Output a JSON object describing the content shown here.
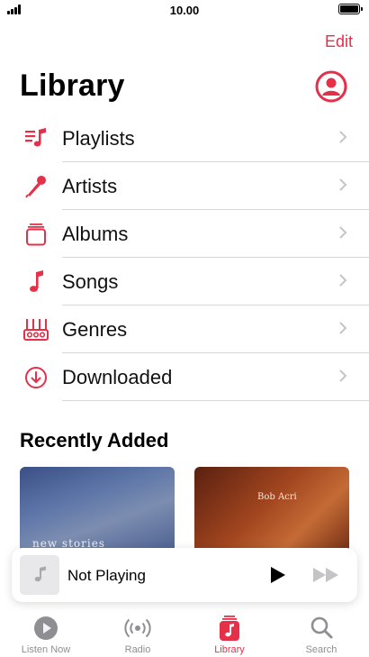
{
  "status_bar": {
    "time": "10.00",
    "battery_level": 1.0
  },
  "header": {
    "edit_label": "Edit",
    "title": "Library"
  },
  "library_items": [
    {
      "label": "Playlists",
      "icon": "playlist-icon"
    },
    {
      "label": "Artists",
      "icon": "microphone-icon"
    },
    {
      "label": "Albums",
      "icon": "album-stack-icon"
    },
    {
      "label": "Songs",
      "icon": "music-note-icon"
    },
    {
      "label": "Genres",
      "icon": "genres-icon"
    },
    {
      "label": "Downloaded",
      "icon": "download-circle-icon"
    }
  ],
  "recently_added": {
    "title": "Recently Added",
    "albums": [
      {
        "art_text": "new stories"
      },
      {
        "art_text": "Bob Acri"
      }
    ]
  },
  "mini_player": {
    "title": "Not Playing"
  },
  "tabs": [
    {
      "label": "Listen Now",
      "icon": "play-circle-icon"
    },
    {
      "label": "Radio",
      "icon": "radio-waves-icon"
    },
    {
      "label": "Library",
      "icon": "library-icon"
    },
    {
      "label": "Search",
      "icon": "search-icon"
    }
  ],
  "colors": {
    "accent": "#e5304a",
    "tab_inactive": "#8e8e93"
  }
}
